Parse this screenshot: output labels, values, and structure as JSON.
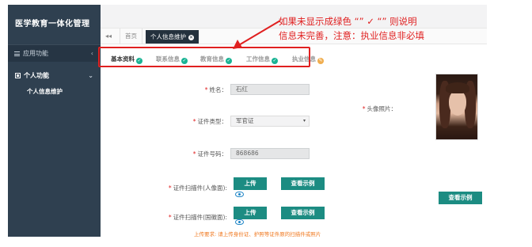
{
  "app": {
    "title": "医学教育一体化管理"
  },
  "sidebar": {
    "app_menu": "应用功能",
    "group": "个人功能",
    "sub_item": "个人信息维护"
  },
  "tabs": {
    "back": "◂◂",
    "home": "首页",
    "active": "个人信息维护"
  },
  "steps": [
    {
      "label": "基本资料",
      "status": "done"
    },
    {
      "label": "联系信息",
      "status": "done"
    },
    {
      "label": "教育信息",
      "status": "done"
    },
    {
      "label": "工作信息",
      "status": "done"
    },
    {
      "label": "执业信息",
      "status": "warning"
    }
  ],
  "annotation": {
    "line1": "如果未显示成绿色 “” ✓ “” 则说明",
    "line2": "信息未完善，注意：执业信息非必填"
  },
  "form": {
    "name_label": "姓名：",
    "name_value": "石红",
    "cert_type_label": "证件类型：",
    "cert_type_value": "军官证",
    "cert_no_label": "证件号码：",
    "cert_no_value": "868686",
    "scan_front_label": "证件扫描件(人像面):",
    "scan_back_label": "证件扫描件(国徽面):",
    "photo_label": "头像照片：",
    "upload_label": "上传",
    "example_label": "查看示例",
    "note": "上传要求: 请上传身份证、护照等证件原的扫描件或照片"
  },
  "colors": {
    "sidebar_bg": "#2f4050",
    "accent": "#1c8c82",
    "success": "#1ab394",
    "warning": "#f0ad4e",
    "annotation": "#e02020"
  }
}
